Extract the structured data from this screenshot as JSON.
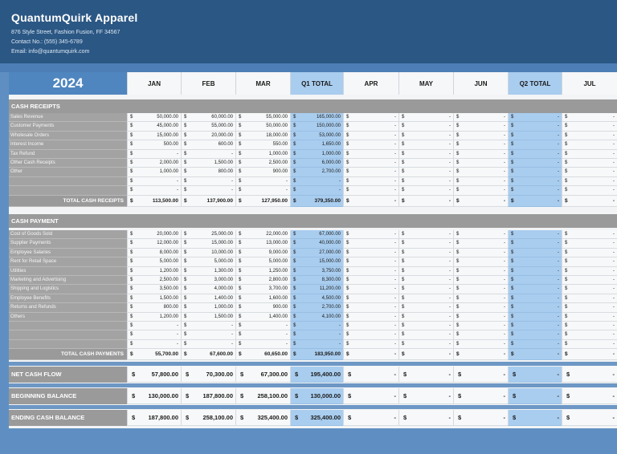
{
  "company": {
    "name": "QuantumQuirk Apparel",
    "address": "876 Style Street, Fashion Fusion, FF 34567",
    "contact": "Contact No.: (555) 345-6789",
    "email": "Email: info@quantumquirk.com"
  },
  "year": "2024",
  "columns": [
    "JAN",
    "FEB",
    "MAR",
    "Q1 TOTAL",
    "APR",
    "MAY",
    "JUN",
    "Q2 TOTAL",
    "JUL"
  ],
  "quarter_columns": [
    3,
    7
  ],
  "colors": {
    "header_bg": "#2b5784",
    "year_bg": "#4f86bf",
    "quarter_bg": "#a9cdef",
    "section_bg": "#9a9a9a",
    "page_bg": "#5f8fc2"
  },
  "receipts": {
    "title": "CASH RECEIPTS",
    "rows": [
      {
        "label": "Sales Revenue",
        "values": [
          "50,000.00",
          "60,000.00",
          "55,000.00",
          "165,000.00",
          "-",
          "-",
          "-",
          "-",
          "-"
        ]
      },
      {
        "label": "Customer Payments",
        "values": [
          "45,000.00",
          "55,000.00",
          "50,000.00",
          "150,000.00",
          "-",
          "-",
          "-",
          "-",
          "-"
        ]
      },
      {
        "label": "Wholesale Orders",
        "values": [
          "15,000.00",
          "20,000.00",
          "18,000.00",
          "53,000.00",
          "-",
          "-",
          "-",
          "-",
          "-"
        ]
      },
      {
        "label": "Interest Income",
        "values": [
          "500.00",
          "600.00",
          "550.00",
          "1,650.00",
          "-",
          "-",
          "-",
          "-",
          "-"
        ]
      },
      {
        "label": "Tax Refund",
        "values": [
          "-",
          "-",
          "1,000.00",
          "1,000.00",
          "-",
          "-",
          "-",
          "-",
          "-"
        ]
      },
      {
        "label": "Other Cash Receipts",
        "values": [
          "2,000.00",
          "1,500.00",
          "2,500.00",
          "6,000.00",
          "-",
          "-",
          "-",
          "-",
          "-"
        ]
      },
      {
        "label": "Other",
        "values": [
          "1,000.00",
          "800.00",
          "900.00",
          "2,700.00",
          "-",
          "-",
          "-",
          "-",
          "-"
        ]
      },
      {
        "label": "",
        "values": [
          "-",
          "-",
          "-",
          "-",
          "-",
          "-",
          "-",
          "-",
          "-"
        ]
      },
      {
        "label": "",
        "values": [
          "-",
          "-",
          "-",
          "-",
          "-",
          "-",
          "-",
          "-",
          "-"
        ]
      }
    ],
    "total": {
      "label": "TOTAL CASH RECEIPTS",
      "values": [
        "113,500.00",
        "137,900.00",
        "127,950.00",
        "379,350.00",
        "-",
        "-",
        "-",
        "-",
        "-"
      ]
    }
  },
  "payments": {
    "title": "CASH PAYMENT",
    "rows": [
      {
        "label": "Cost of Goods Sold",
        "values": [
          "20,000.00",
          "25,000.00",
          "22,000.00",
          "67,000.00",
          "-",
          "-",
          "-",
          "-",
          "-"
        ]
      },
      {
        "label": "Supplier Payments",
        "values": [
          "12,000.00",
          "15,000.00",
          "13,000.00",
          "40,000.00",
          "-",
          "-",
          "-",
          "-",
          "-"
        ]
      },
      {
        "label": "Employee Salaries",
        "values": [
          "8,000.00",
          "10,000.00",
          "9,000.00",
          "27,000.00",
          "-",
          "-",
          "-",
          "-",
          "-"
        ]
      },
      {
        "label": "Rent for Retail Space",
        "values": [
          "5,000.00",
          "5,000.00",
          "5,000.00",
          "15,000.00",
          "-",
          "-",
          "-",
          "-",
          "-"
        ]
      },
      {
        "label": "Utilities",
        "values": [
          "1,200.00",
          "1,300.00",
          "1,250.00",
          "3,750.00",
          "-",
          "-",
          "-",
          "-",
          "-"
        ]
      },
      {
        "label": "Marketing and Advertising",
        "values": [
          "2,500.00",
          "3,000.00",
          "2,800.00",
          "8,300.00",
          "-",
          "-",
          "-",
          "-",
          "-"
        ]
      },
      {
        "label": "Shipping and Logistics",
        "values": [
          "3,500.00",
          "4,000.00",
          "3,700.00",
          "11,200.00",
          "-",
          "-",
          "-",
          "-",
          "-"
        ]
      },
      {
        "label": "Employee Benefits",
        "values": [
          "1,500.00",
          "1,400.00",
          "1,600.00",
          "4,500.00",
          "-",
          "-",
          "-",
          "-",
          "-"
        ]
      },
      {
        "label": "Returns and Refunds",
        "values": [
          "800.00",
          "1,000.00",
          "900.00",
          "2,700.00",
          "-",
          "-",
          "-",
          "-",
          "-"
        ]
      },
      {
        "label": "Others",
        "values": [
          "1,200.00",
          "1,500.00",
          "1,400.00",
          "4,100.00",
          "-",
          "-",
          "-",
          "-",
          "-"
        ]
      },
      {
        "label": "",
        "values": [
          "-",
          "-",
          "-",
          "-",
          "-",
          "-",
          "-",
          "-",
          "-"
        ]
      },
      {
        "label": "",
        "values": [
          "-",
          "-",
          "-",
          "-",
          "-",
          "-",
          "-",
          "-",
          "-"
        ]
      },
      {
        "label": "",
        "values": [
          "-",
          "-",
          "-",
          "-",
          "-",
          "-",
          "-",
          "-",
          "-"
        ]
      }
    ],
    "total": {
      "label": "TOTAL CASH PAYMENTS",
      "values": [
        "55,700.00",
        "67,600.00",
        "60,650.00",
        "183,950.00",
        "-",
        "-",
        "-",
        "-",
        "-"
      ]
    }
  },
  "summary": [
    {
      "label": "NET CASH FLOW",
      "values": [
        "57,800.00",
        "70,300.00",
        "67,300.00",
        "195,400.00",
        "-",
        "-",
        "-",
        "-",
        "-"
      ]
    },
    {
      "label": "BEGINNING BALANCE",
      "values": [
        "130,000.00",
        "187,800.00",
        "258,100.00",
        "130,000.00",
        "-",
        "-",
        "-",
        "-",
        "-"
      ]
    },
    {
      "label": "ENDING CASH BALANCE",
      "values": [
        "187,800.00",
        "258,100.00",
        "325,400.00",
        "325,400.00",
        "-",
        "-",
        "-",
        "-",
        "-"
      ]
    }
  ],
  "currency_symbol": "$"
}
